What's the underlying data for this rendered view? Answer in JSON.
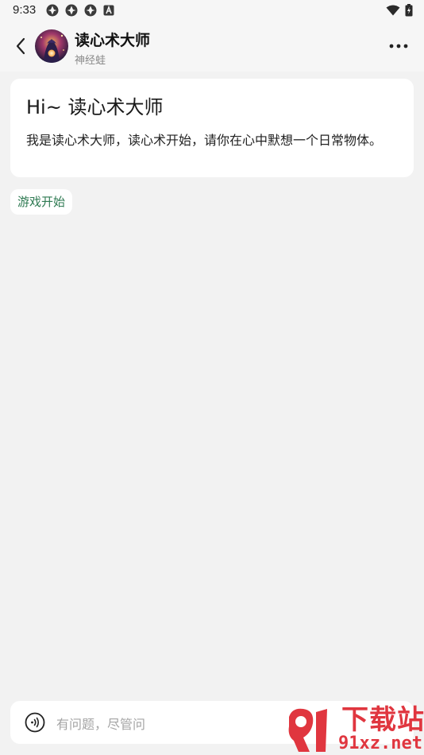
{
  "status_bar": {
    "time": "9:33",
    "left_icons": [
      "app-notification-icon",
      "app-notification-icon",
      "app-notification-icon",
      "a-square-icon"
    ],
    "right_icons": [
      "wifi-icon",
      "battery-charging-icon"
    ]
  },
  "header": {
    "title": "读心术大师",
    "subtitle": "神经蛙",
    "back_icon": "chevron-left-icon",
    "more_icon": "more-horizontal-icon"
  },
  "greeting": {
    "title": "Hi~ 读心术大师",
    "text": "我是读心术大师，读心术开始，请你在心中默想一个日常物体。"
  },
  "suggestions": [
    {
      "label": "游戏开始"
    }
  ],
  "input": {
    "placeholder": "有问题，尽管问",
    "voice_icon": "voice-wave-icon"
  },
  "watermark": {
    "top": "下载站",
    "bottom": "91xz.net"
  },
  "colors": {
    "background": "#f2f2f2",
    "card": "#ffffff",
    "chip_text": "#2e7a52",
    "watermark": "#e0363f"
  }
}
